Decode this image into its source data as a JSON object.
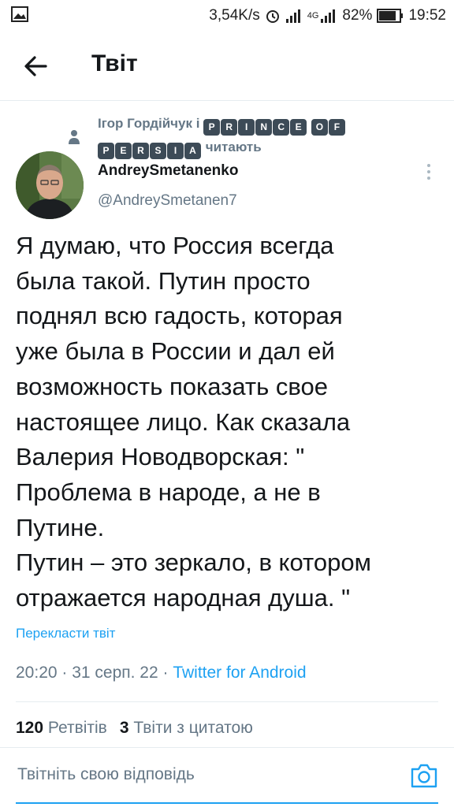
{
  "status_bar": {
    "speed": "3,54K/s",
    "network": "4G",
    "battery": "82%",
    "time": "19:52",
    "icons": [
      "gallery-icon",
      "alarm-icon",
      "signal-icon",
      "signal-4g-icon",
      "battery-icon"
    ]
  },
  "header": {
    "title": "Твіт",
    "back_icon": "arrow-left-icon"
  },
  "social_context": {
    "prefix": "Ігор Гордійчук і",
    "badge_word_1": [
      "P",
      "R",
      "I",
      "N",
      "C",
      "E"
    ],
    "badge_word_2": [
      "O",
      "F"
    ],
    "badge_word_3": [
      "P",
      "E",
      "R",
      "S",
      "I",
      "A"
    ],
    "suffix": "читають",
    "icon": "person-icon"
  },
  "tweet": {
    "author_name": "AndreySmetanenko",
    "author_handle": "@AndreySmetanen7",
    "text": "Я думаю, что Россия всегда\nбыла такой. Путин просто\nподнял всю гадость, которая\nуже была в России и дал ей\nвозможность показать свое\nнастоящее лицо. Как сказала\nВалерия Новодворская: \"\nПроблема в народе, а не в\nПутине.\nПутин – это зеркало, в котором\nотражается народная душа. \"",
    "translate_label": "Перекласти твіт",
    "timestamp": "20:20 · 31 серп. 22 · ",
    "source": "Twitter for Android"
  },
  "stats": {
    "retweets_count": "120",
    "retweets_label": "Ретвітів",
    "quotes_count": "3",
    "quotes_label": "Твіти з цитатою"
  },
  "reply": {
    "placeholder": "Твітніть свою відповідь",
    "camera_icon": "camera-icon"
  },
  "colors": {
    "accent": "#1da1f2",
    "secondary_text": "#657786",
    "primary_text": "#14171a"
  }
}
